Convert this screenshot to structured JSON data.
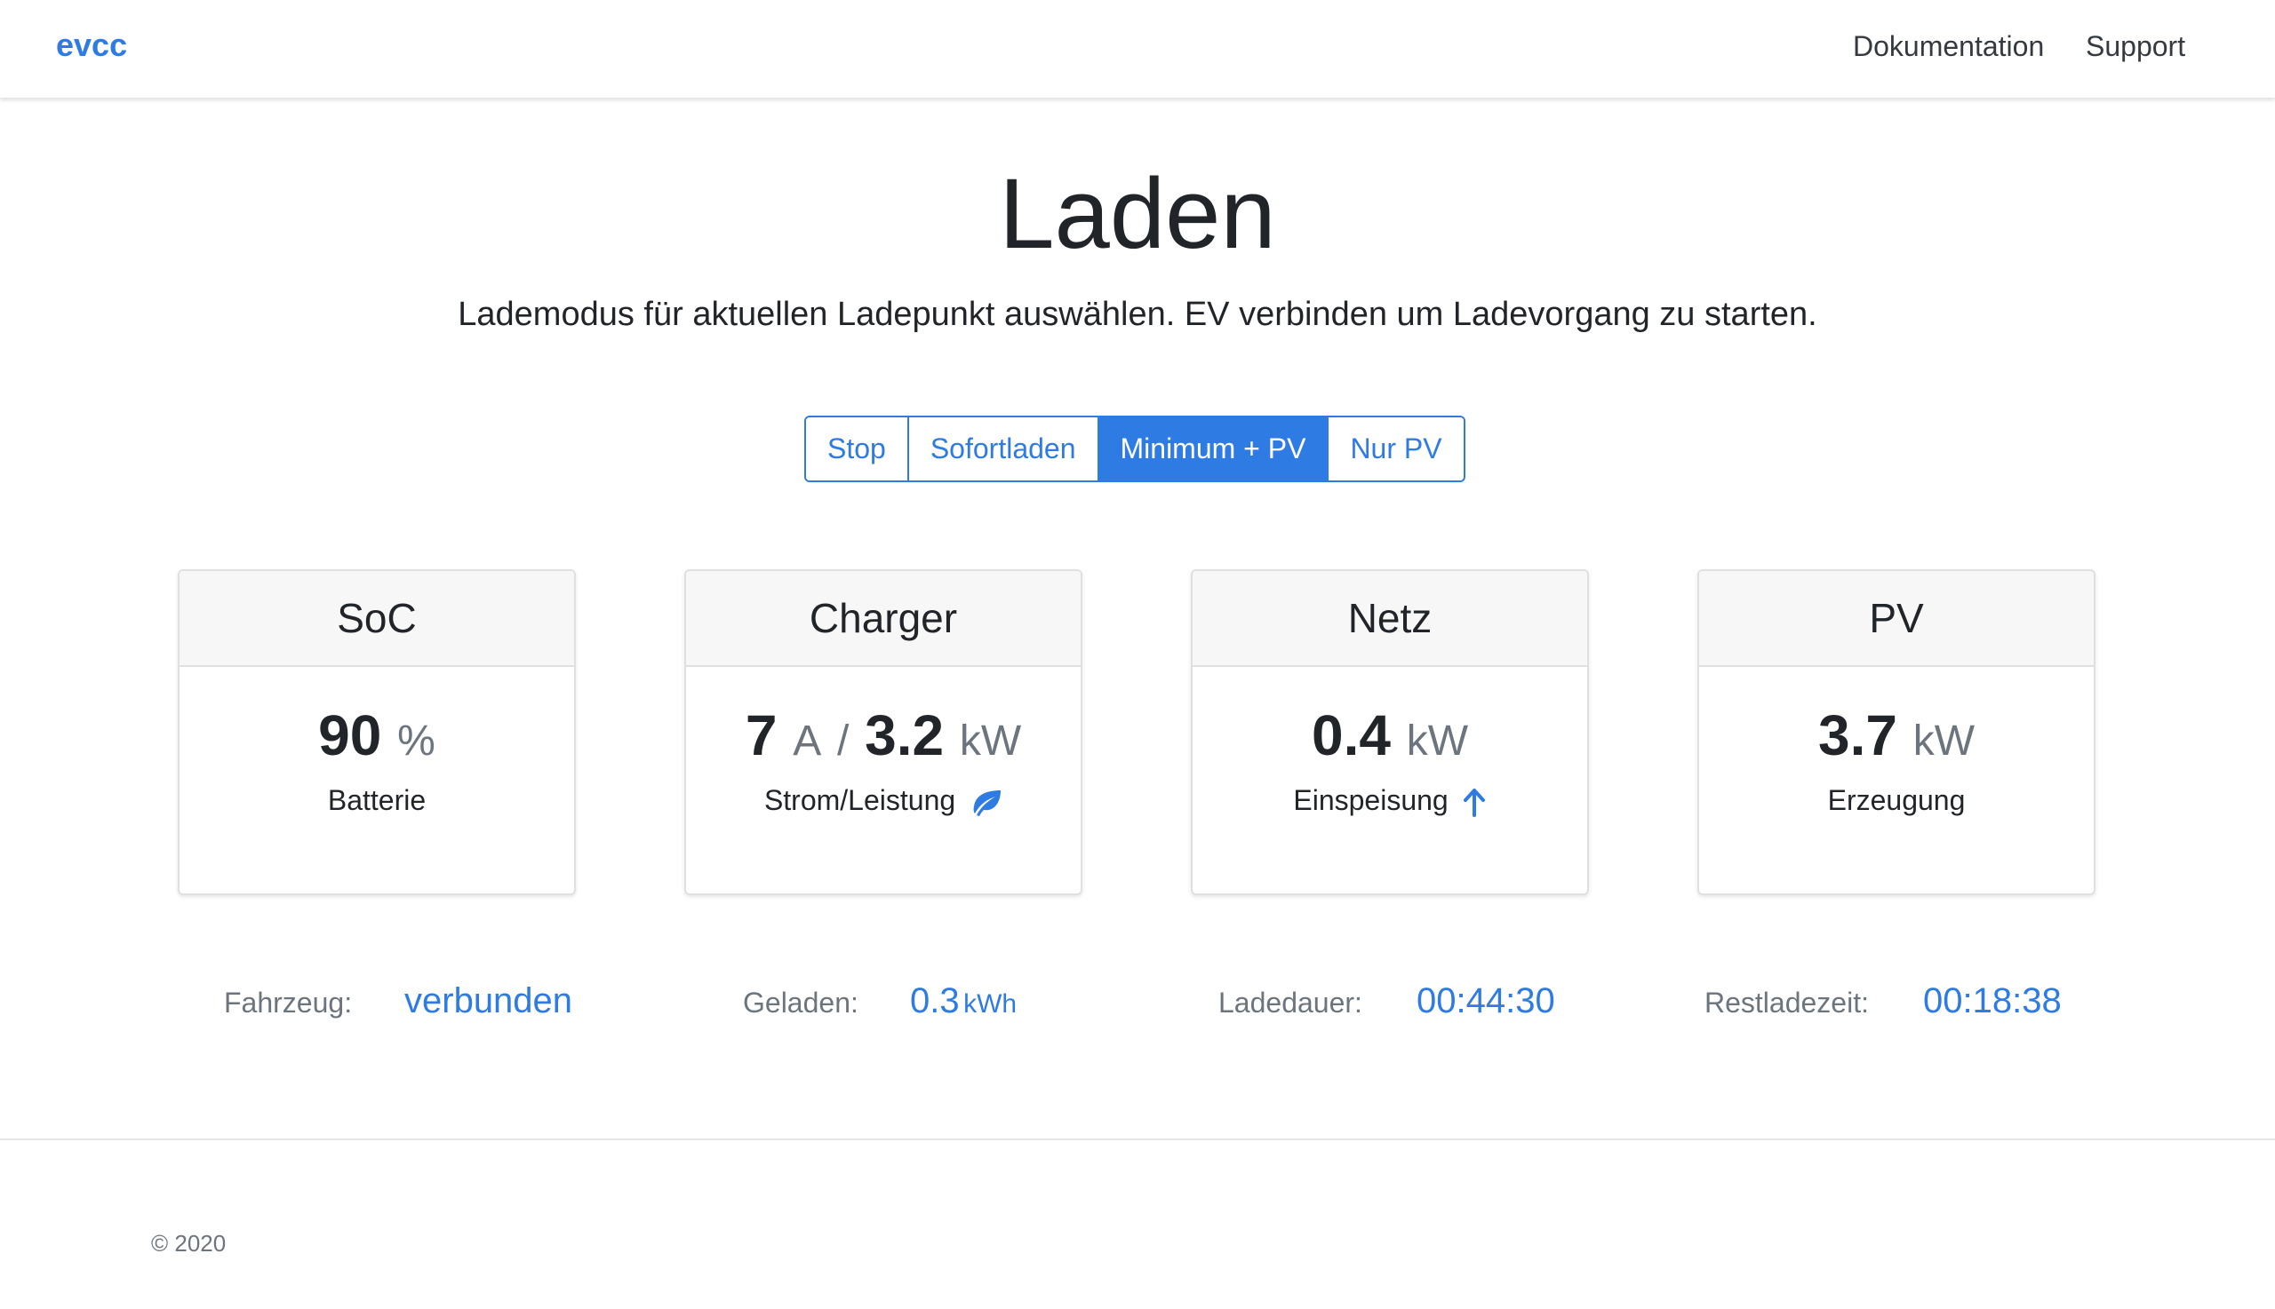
{
  "navbar": {
    "brand": "evcc",
    "links": [
      "Dokumentation",
      "Support"
    ]
  },
  "page": {
    "title": "Laden",
    "lead": "Lademodus für aktuellen Ladepunkt auswählen. EV verbinden um Ladevorgang zu starten."
  },
  "modes": {
    "options": [
      "Stop",
      "Sofortladen",
      "Minimum + PV",
      "Nur PV"
    ],
    "selected": "Minimum + PV"
  },
  "cards": [
    {
      "title": "SoC",
      "value": "90",
      "unit": "%",
      "label": "Batterie",
      "icon": ""
    },
    {
      "title": "Charger",
      "value": "7",
      "unit": "A",
      "value2": "3.2",
      "unit2": "kW",
      "label": "Strom/Leistung",
      "icon": "leaf-icon"
    },
    {
      "title": "Netz",
      "value": "0.4",
      "unit": "kW",
      "label": "Einspeisung",
      "icon": "arrow-up-icon"
    },
    {
      "title": "PV",
      "value": "3.7",
      "unit": "kW",
      "label": "Erzeugung",
      "icon": ""
    }
  ],
  "stats": [
    {
      "label": "Fahrzeug:",
      "value": "verbunden",
      "unit": ""
    },
    {
      "label": "Geladen:",
      "value": "0.3",
      "unit": "kWh"
    },
    {
      "label": "Ladedauer:",
      "value": "00:44:30",
      "unit": ""
    },
    {
      "label": "Restladezeit:",
      "value": "00:18:38",
      "unit": ""
    }
  ],
  "footer": {
    "copyright": "© 2020"
  },
  "colors": {
    "accent": "#2d7be3"
  }
}
